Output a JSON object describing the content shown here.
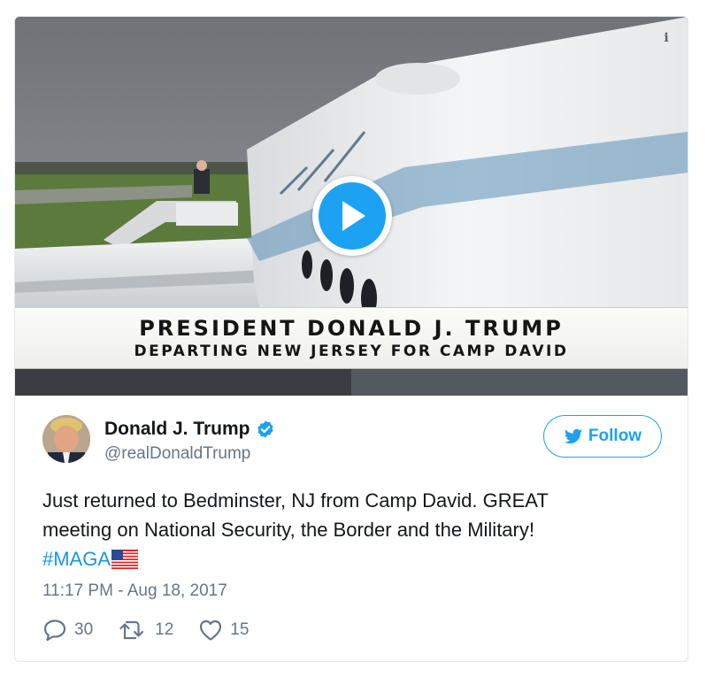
{
  "media": {
    "info_icon": "info-icon",
    "play_icon": "play-icon",
    "lower_third_line1": "PRESIDENT DONALD J. TRUMP",
    "lower_third_line2": "DEPARTING NEW JERSEY FOR CAMP DAVID"
  },
  "author": {
    "display_name": "Donald J. Trump",
    "screen_name": "@realDonaldTrump",
    "verified": true
  },
  "follow": {
    "label": "Follow"
  },
  "tweet": {
    "text_line1": "Just returned to Bedminster, NJ from Camp David. GREAT",
    "text_line2": "meeting on National Security, the Border and the Military!",
    "hashtag": "#MAGA",
    "emoji": "us-flag-emoji",
    "timestamp": "11:17 PM - Aug 18, 2017"
  },
  "actions": {
    "replies": "30",
    "retweets": "12",
    "likes": "15"
  },
  "colors": {
    "accent": "#1da1f2",
    "hashtag": "#1b95e0",
    "muted": "#657786",
    "border": "#e1e8ed"
  }
}
